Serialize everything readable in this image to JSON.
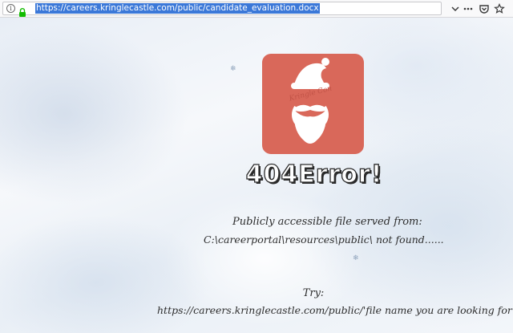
{
  "browser": {
    "url": "https://careers.kringlecastle.com/public/candidate_evaluation.docx",
    "icons": {
      "info": "info-icon",
      "lock": "lock-icon",
      "dropdown": "chevron-down-icon",
      "bookmark": "bookmark-star-icon",
      "pocket": "pocket-icon",
      "more": "more-actions-icon"
    }
  },
  "page": {
    "logo": {
      "icon": "santa-logo-icon",
      "watermark": "Kringle Con",
      "background_color": "#d9685a"
    },
    "error_title": "404Error!",
    "message_line1": "Publicly accessible file served from:",
    "message_line2": "C:\\careerportal\\resources\\public\\ not found......",
    "try_label": "Try:",
    "try_url": "https://careers.kringlecastle.com/public/'file name you are looking for'"
  }
}
